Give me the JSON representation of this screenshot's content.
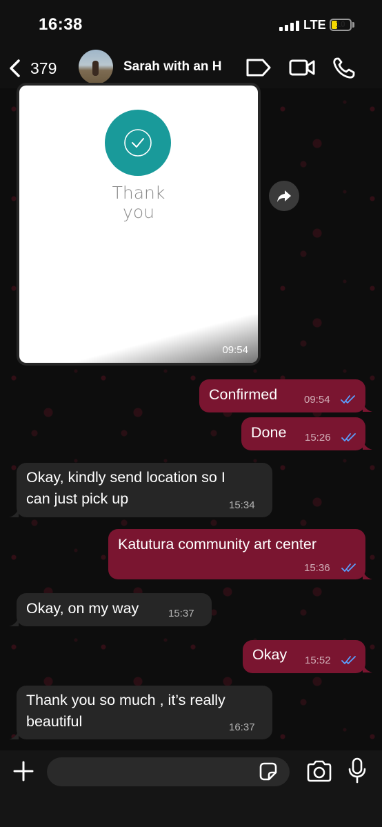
{
  "status_bar": {
    "time": "16:38",
    "network": "LTE",
    "battery": "10"
  },
  "header": {
    "back_count": "379",
    "contact_name": "Sarah with an H",
    "icons": [
      "back-chevron-icon",
      "label-tag-icon",
      "video-call-icon",
      "phone-call-icon"
    ]
  },
  "image_message": {
    "line1": "Thank",
    "line2": "you",
    "time": "09:54"
  },
  "messages": [
    {
      "direction": "out",
      "text": "Confirmed",
      "time": "09:54",
      "read": true
    },
    {
      "direction": "out",
      "text": "Done",
      "time": "15:26",
      "read": true
    },
    {
      "direction": "in",
      "lines": [
        "Okay, kindly send location so I",
        "can just pick up"
      ],
      "time": "15:34"
    },
    {
      "direction": "out",
      "text": "Katutura community art center",
      "time": "15:36",
      "read": true
    },
    {
      "direction": "in",
      "text": "Okay, on my way",
      "time": "15:37"
    },
    {
      "direction": "out",
      "text": "Okay",
      "time": "15:52",
      "read": true
    },
    {
      "direction": "in",
      "lines": [
        "Thank you so much , it’s really",
        "beautiful"
      ],
      "time": "16:37"
    }
  ],
  "composer": {
    "placeholder": "",
    "icons": [
      "plus-icon",
      "sticker-icon",
      "camera-icon",
      "microphone-icon"
    ]
  },
  "colors": {
    "outgoing_bubble": "#7a1530",
    "incoming_bubble": "#262626",
    "read_ticks": "#5aa0ff",
    "check_circle": "#199a9a"
  }
}
